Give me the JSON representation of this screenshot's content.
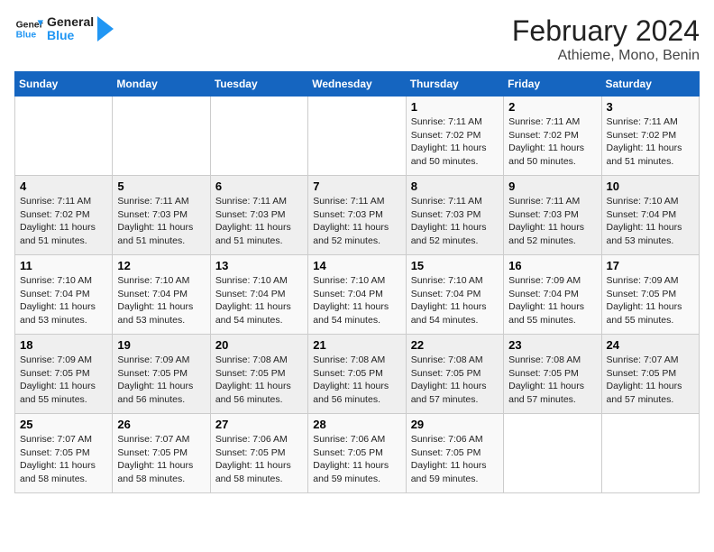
{
  "logo": {
    "text_general": "General",
    "text_blue": "Blue"
  },
  "title": "February 2024",
  "subtitle": "Athieme, Mono, Benin",
  "days_of_week": [
    "Sunday",
    "Monday",
    "Tuesday",
    "Wednesday",
    "Thursday",
    "Friday",
    "Saturday"
  ],
  "weeks": [
    [
      {
        "day": "",
        "sunrise": "",
        "sunset": "",
        "daylight": "",
        "empty": true
      },
      {
        "day": "",
        "sunrise": "",
        "sunset": "",
        "daylight": "",
        "empty": true
      },
      {
        "day": "",
        "sunrise": "",
        "sunset": "",
        "daylight": "",
        "empty": true
      },
      {
        "day": "",
        "sunrise": "",
        "sunset": "",
        "daylight": "",
        "empty": true
      },
      {
        "day": "1",
        "sunrise": "Sunrise: 7:11 AM",
        "sunset": "Sunset: 7:02 PM",
        "daylight": "Daylight: 11 hours and 50 minutes."
      },
      {
        "day": "2",
        "sunrise": "Sunrise: 7:11 AM",
        "sunset": "Sunset: 7:02 PM",
        "daylight": "Daylight: 11 hours and 50 minutes."
      },
      {
        "day": "3",
        "sunrise": "Sunrise: 7:11 AM",
        "sunset": "Sunset: 7:02 PM",
        "daylight": "Daylight: 11 hours and 51 minutes."
      }
    ],
    [
      {
        "day": "4",
        "sunrise": "Sunrise: 7:11 AM",
        "sunset": "Sunset: 7:02 PM",
        "daylight": "Daylight: 11 hours and 51 minutes."
      },
      {
        "day": "5",
        "sunrise": "Sunrise: 7:11 AM",
        "sunset": "Sunset: 7:03 PM",
        "daylight": "Daylight: 11 hours and 51 minutes."
      },
      {
        "day": "6",
        "sunrise": "Sunrise: 7:11 AM",
        "sunset": "Sunset: 7:03 PM",
        "daylight": "Daylight: 11 hours and 51 minutes."
      },
      {
        "day": "7",
        "sunrise": "Sunrise: 7:11 AM",
        "sunset": "Sunset: 7:03 PM",
        "daylight": "Daylight: 11 hours and 52 minutes."
      },
      {
        "day": "8",
        "sunrise": "Sunrise: 7:11 AM",
        "sunset": "Sunset: 7:03 PM",
        "daylight": "Daylight: 11 hours and 52 minutes."
      },
      {
        "day": "9",
        "sunrise": "Sunrise: 7:11 AM",
        "sunset": "Sunset: 7:03 PM",
        "daylight": "Daylight: 11 hours and 52 minutes."
      },
      {
        "day": "10",
        "sunrise": "Sunrise: 7:10 AM",
        "sunset": "Sunset: 7:04 PM",
        "daylight": "Daylight: 11 hours and 53 minutes."
      }
    ],
    [
      {
        "day": "11",
        "sunrise": "Sunrise: 7:10 AM",
        "sunset": "Sunset: 7:04 PM",
        "daylight": "Daylight: 11 hours and 53 minutes."
      },
      {
        "day": "12",
        "sunrise": "Sunrise: 7:10 AM",
        "sunset": "Sunset: 7:04 PM",
        "daylight": "Daylight: 11 hours and 53 minutes."
      },
      {
        "day": "13",
        "sunrise": "Sunrise: 7:10 AM",
        "sunset": "Sunset: 7:04 PM",
        "daylight": "Daylight: 11 hours and 54 minutes."
      },
      {
        "day": "14",
        "sunrise": "Sunrise: 7:10 AM",
        "sunset": "Sunset: 7:04 PM",
        "daylight": "Daylight: 11 hours and 54 minutes."
      },
      {
        "day": "15",
        "sunrise": "Sunrise: 7:10 AM",
        "sunset": "Sunset: 7:04 PM",
        "daylight": "Daylight: 11 hours and 54 minutes."
      },
      {
        "day": "16",
        "sunrise": "Sunrise: 7:09 AM",
        "sunset": "Sunset: 7:04 PM",
        "daylight": "Daylight: 11 hours and 55 minutes."
      },
      {
        "day": "17",
        "sunrise": "Sunrise: 7:09 AM",
        "sunset": "Sunset: 7:05 PM",
        "daylight": "Daylight: 11 hours and 55 minutes."
      }
    ],
    [
      {
        "day": "18",
        "sunrise": "Sunrise: 7:09 AM",
        "sunset": "Sunset: 7:05 PM",
        "daylight": "Daylight: 11 hours and 55 minutes."
      },
      {
        "day": "19",
        "sunrise": "Sunrise: 7:09 AM",
        "sunset": "Sunset: 7:05 PM",
        "daylight": "Daylight: 11 hours and 56 minutes."
      },
      {
        "day": "20",
        "sunrise": "Sunrise: 7:08 AM",
        "sunset": "Sunset: 7:05 PM",
        "daylight": "Daylight: 11 hours and 56 minutes."
      },
      {
        "day": "21",
        "sunrise": "Sunrise: 7:08 AM",
        "sunset": "Sunset: 7:05 PM",
        "daylight": "Daylight: 11 hours and 56 minutes."
      },
      {
        "day": "22",
        "sunrise": "Sunrise: 7:08 AM",
        "sunset": "Sunset: 7:05 PM",
        "daylight": "Daylight: 11 hours and 57 minutes."
      },
      {
        "day": "23",
        "sunrise": "Sunrise: 7:08 AM",
        "sunset": "Sunset: 7:05 PM",
        "daylight": "Daylight: 11 hours and 57 minutes."
      },
      {
        "day": "24",
        "sunrise": "Sunrise: 7:07 AM",
        "sunset": "Sunset: 7:05 PM",
        "daylight": "Daylight: 11 hours and 57 minutes."
      }
    ],
    [
      {
        "day": "25",
        "sunrise": "Sunrise: 7:07 AM",
        "sunset": "Sunset: 7:05 PM",
        "daylight": "Daylight: 11 hours and 58 minutes."
      },
      {
        "day": "26",
        "sunrise": "Sunrise: 7:07 AM",
        "sunset": "Sunset: 7:05 PM",
        "daylight": "Daylight: 11 hours and 58 minutes."
      },
      {
        "day": "27",
        "sunrise": "Sunrise: 7:06 AM",
        "sunset": "Sunset: 7:05 PM",
        "daylight": "Daylight: 11 hours and 58 minutes."
      },
      {
        "day": "28",
        "sunrise": "Sunrise: 7:06 AM",
        "sunset": "Sunset: 7:05 PM",
        "daylight": "Daylight: 11 hours and 59 minutes."
      },
      {
        "day": "29",
        "sunrise": "Sunrise: 7:06 AM",
        "sunset": "Sunset: 7:05 PM",
        "daylight": "Daylight: 11 hours and 59 minutes."
      },
      {
        "day": "",
        "sunrise": "",
        "sunset": "",
        "daylight": "",
        "empty": true
      },
      {
        "day": "",
        "sunrise": "",
        "sunset": "",
        "daylight": "",
        "empty": true
      }
    ]
  ]
}
